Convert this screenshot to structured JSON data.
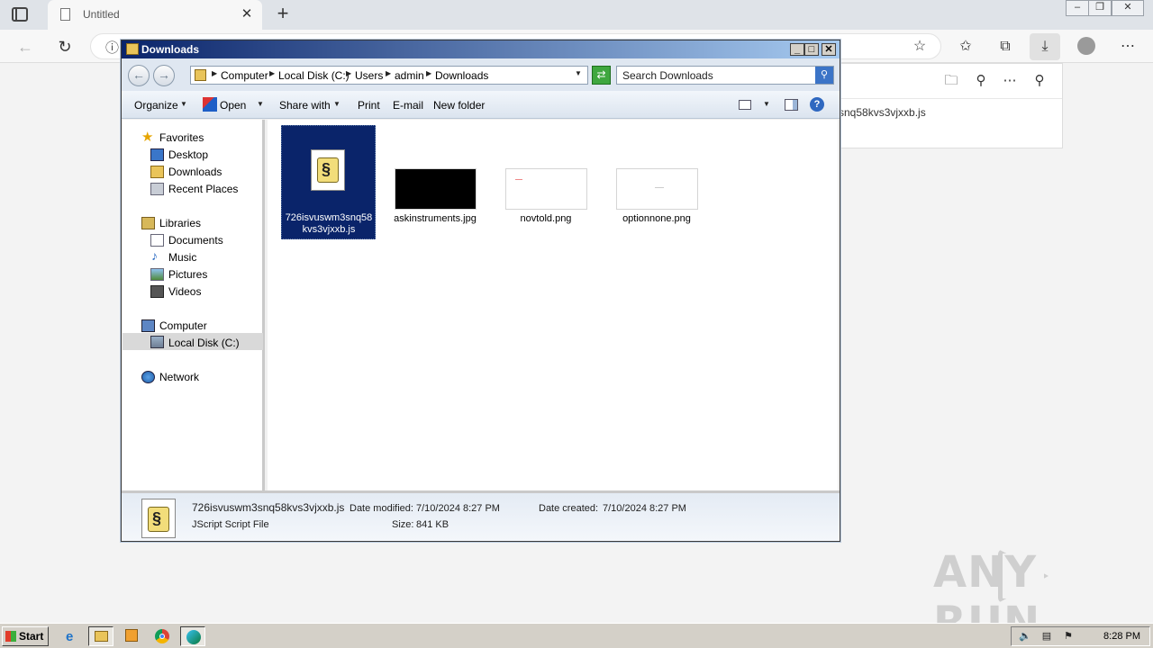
{
  "browser": {
    "tab_title": "Untitled",
    "tab_close": "✕",
    "new_tab": "+",
    "address_info_icon": "ⓘ",
    "download_panel_filename": "snq58kvs3vjxxb.js"
  },
  "explorer": {
    "window_title": "Downloads",
    "breadcrumb": [
      "Computer",
      "Local Disk (C:)",
      "Users",
      "admin",
      "Downloads"
    ],
    "search_placeholder": "Search Downloads",
    "commands": {
      "organize": "Organize",
      "open": "Open",
      "share_with": "Share with",
      "print": "Print",
      "email": "E-mail",
      "new_folder": "New folder"
    },
    "nav": {
      "favorites": "Favorites",
      "desktop": "Desktop",
      "downloads": "Downloads",
      "recent_places": "Recent Places",
      "libraries": "Libraries",
      "documents": "Documents",
      "music": "Music",
      "pictures": "Pictures",
      "videos": "Videos",
      "computer": "Computer",
      "local_disk": "Local Disk (C:)",
      "network": "Network"
    },
    "files": [
      {
        "name_line1": "726isvuswm3snq58",
        "name_line2": "kvs3vjxxb.js",
        "thumb_color": "#0a246a"
      },
      {
        "name": "askinstruments.jpg",
        "thumb_color": "#000000"
      },
      {
        "name": "novtold.png",
        "thumb_color": "#ffffff"
      },
      {
        "name": "optionnone.png",
        "thumb_color": "#ffffff"
      }
    ],
    "details": {
      "filename": "726isvuswm3snq58kvs3vjxxb.js",
      "modified_label": "Date modified:",
      "modified_value": "7/10/2024 8:27 PM",
      "created_label": "Date created:",
      "created_value": "7/10/2024 8:27 PM",
      "type": "JScript Script File",
      "size_label": "Size:",
      "size_value": "841 KB"
    }
  },
  "taskbar": {
    "start_label": "Start",
    "clock": "8:28 PM"
  },
  "watermark": "ANY RUN",
  "colors": {
    "title_bar": "#0a246a",
    "selection": "#0a246a",
    "taskbar": "#d4d0c8"
  },
  "icons": [
    "sidebar-icon",
    "document-icon",
    "back-icon",
    "refresh-icon",
    "info-icon",
    "favorite-add-icon",
    "favorites-icon",
    "collections-icon",
    "download-icon",
    "profile-icon",
    "more-icon",
    "folder-icon",
    "search-icon",
    "pin-icon"
  ]
}
